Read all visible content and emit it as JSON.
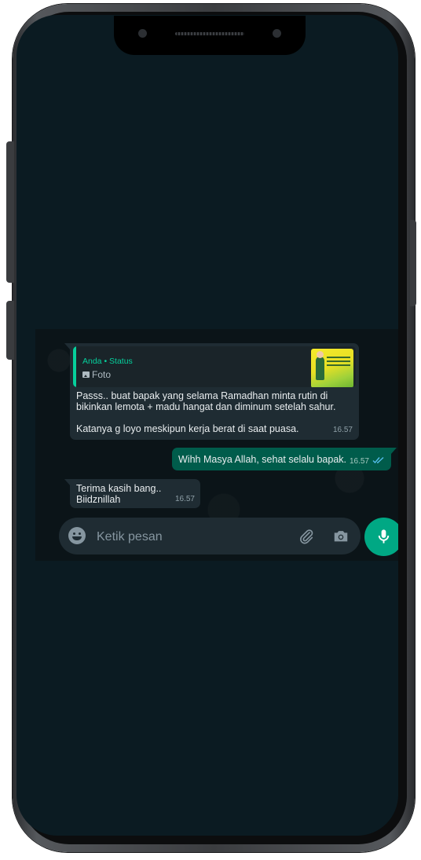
{
  "quoted": {
    "author": "Anda • Status",
    "type_label": "Foto"
  },
  "messages": [
    {
      "direction": "incoming",
      "text": "Passs.. buat bapak yang selama Ramadhan minta rutin di\nbikinkan lemota + madu hangat dan diminum setelah sahur.\n\nKatanya g loyo meskipun kerja berat di saat puasa.",
      "time": "16.57"
    },
    {
      "direction": "outgoing",
      "text": "Wihh Masya Allah, sehat selalu bapak.",
      "time": "16.57",
      "status": "read"
    },
    {
      "direction": "incoming",
      "text": "Terima kasih bang..\nBiidznillah",
      "time": "16.57"
    }
  ],
  "composer": {
    "placeholder": "Ketik pesan",
    "emoji_icon": "emoji-icon",
    "attach_icon": "paperclip-icon",
    "camera_icon": "camera-icon",
    "mic_icon": "mic-icon"
  },
  "colors": {
    "accent": "#00a884",
    "outgoing_bubble": "#005c4b",
    "incoming_bubble": "#1f2c33",
    "read_tick": "#53bdeb",
    "background": "#0b1418"
  }
}
